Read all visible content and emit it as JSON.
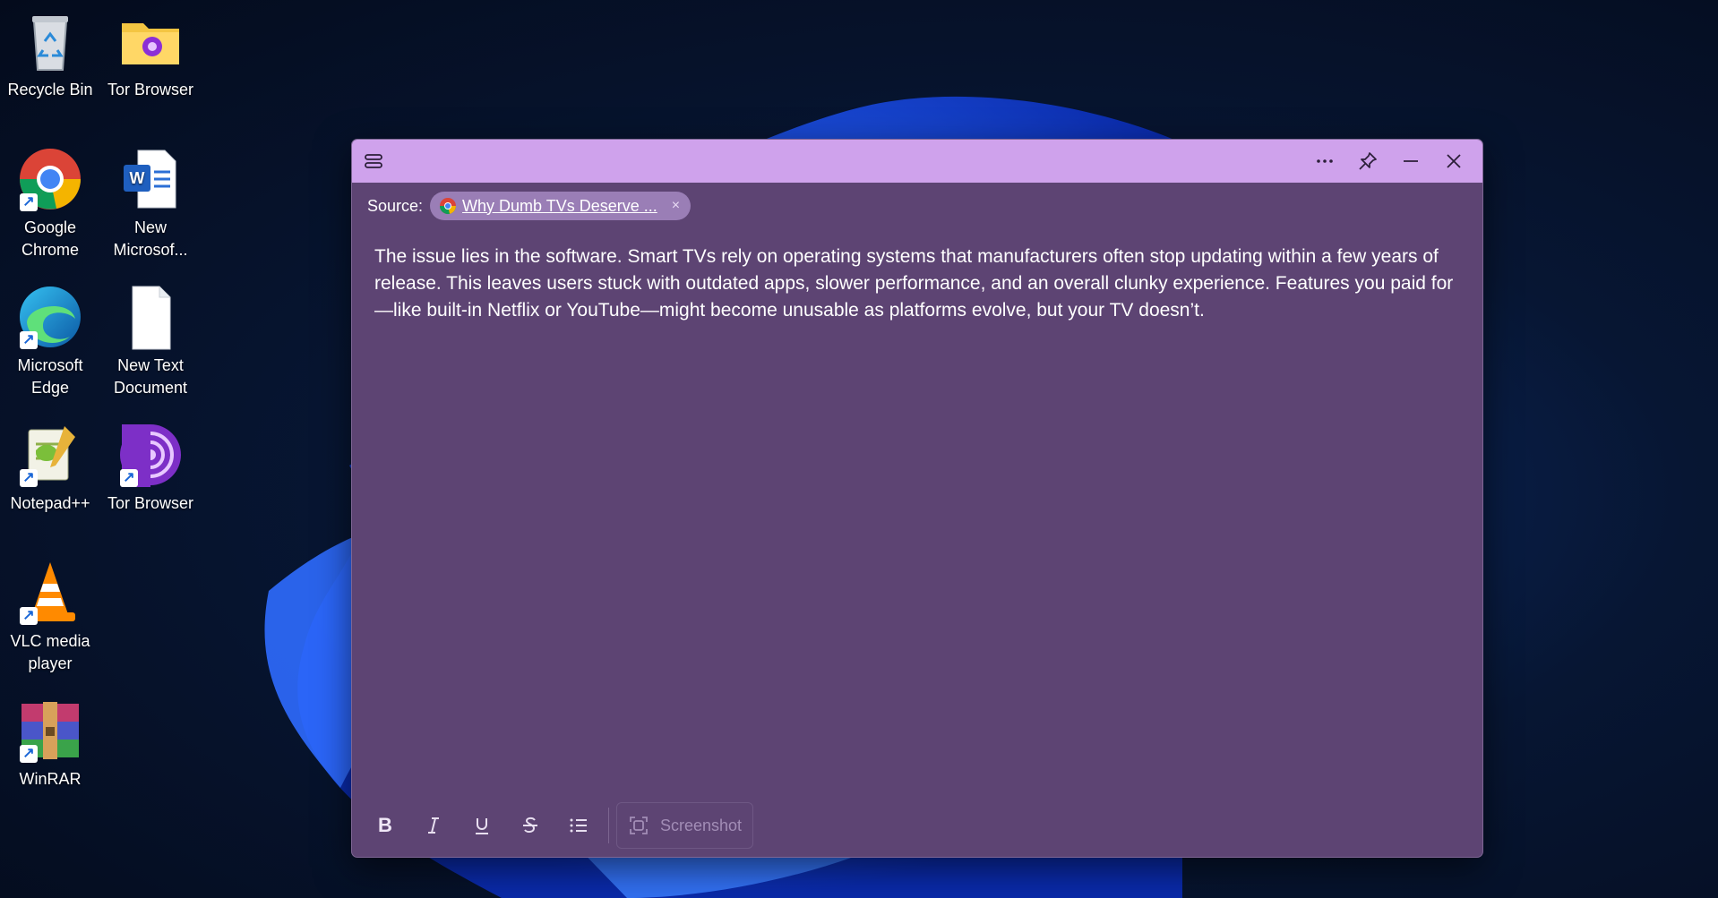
{
  "desktop": {
    "icons": [
      {
        "label": "Recycle Bin"
      },
      {
        "label": "Tor Browser"
      },
      {
        "label": "Google Chrome"
      },
      {
        "label": "New Microsof..."
      },
      {
        "label": "Microsoft Edge"
      },
      {
        "label": "New Text Document"
      },
      {
        "label": "Notepad++"
      },
      {
        "label": "Tor Browser"
      },
      {
        "label": "VLC media player"
      },
      {
        "label": "WinRAR"
      }
    ]
  },
  "note": {
    "colors": {
      "titlebar": "#cfa2ec",
      "body": "#5d4473"
    },
    "titlebar_icons": [
      "menu-icon",
      "more-icon",
      "pin-icon",
      "minimize-icon",
      "close-icon"
    ],
    "source_label": "Source:",
    "source_link": "Why Dumb TVs Deserve ...",
    "chip_close": "×",
    "content": "The issue lies in the software. Smart TVs rely on operating systems that manufacturers often stop updating within a few years of release. This leaves users stuck with outdated apps, slower performance, and an overall clunky experience. Features you paid for—like built-in Netflix or YouTube—might become unusable as platforms evolve, but your TV doesn’t.",
    "toolbar": {
      "bold": "B",
      "screenshot_label": "Screenshot"
    }
  }
}
